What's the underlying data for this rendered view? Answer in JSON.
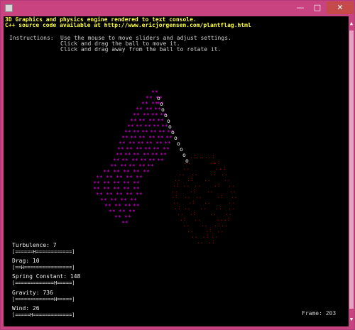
{
  "header": {
    "line1": "3D Graphics and physics engine rendered to text console.",
    "line2": "C++ source code available at http://www.ericjorgensen.com/plantflag.html"
  },
  "instructions": {
    "label": "Instructions:",
    "line1": "Use the mouse to move sliders and adjust settings.",
    "line2": "Click and drag the ball to move it.",
    "line3": "Click and drag away from the ball to rotate it."
  },
  "sliders": [
    {
      "label": "Turbulence: 7",
      "bar": "[======H============]",
      "value": 7
    },
    {
      "label": "Drag: 10",
      "bar": "[==H================]",
      "value": 10
    },
    {
      "label": "Spring Constant: 148",
      "bar": "[=============H=====]",
      "value": 148
    },
    {
      "label": "Gravity: 736",
      "bar": "[=============H=====]",
      "value": 736
    },
    {
      "label": "Wind: 26",
      "bar": "[=====H=============]",
      "value": 26
    }
  ],
  "frame": {
    "text": "Frame: 203"
  },
  "colors": {
    "flag": "#e000e0",
    "shadow": "#b00000",
    "pole": "#ffffff",
    "title_bar": "#c8437f",
    "close_button": "#c74a4a"
  },
  "icons": {
    "app": "console-window-icon",
    "minimize": "minimize-icon",
    "maximize": "maximize-icon",
    "close": "close-icon"
  }
}
